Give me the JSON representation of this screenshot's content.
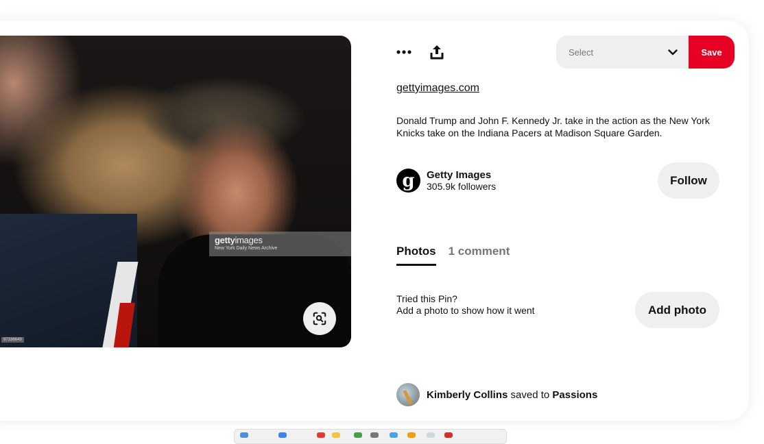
{
  "pin": {
    "image_alt": "Donald Trump and John F. Kennedy Jr. at a Knicks game",
    "watermark": {
      "brand_bold": "getty",
      "brand_light": "images",
      "credit": "New York Daily News Archive"
    },
    "image_id_tag": "97336649",
    "visual_search_icon": "lens-search-icon"
  },
  "toolbar": {
    "more_icon": "more-horizontal-icon",
    "share_icon": "share-icon",
    "board_select": {
      "placeholder": "Select",
      "icon": "chevron-down-icon"
    },
    "save_label": "Save"
  },
  "source_link": "gettyimages.com",
  "description": "Donald Trump and John F. Kennedy Jr. take in the action as the New York Knicks take on the Indiana Pacers at Madison Square Garden.",
  "creator": {
    "avatar_letter": "g",
    "name": "Getty Images",
    "followers": "305.9k followers",
    "follow_label": "Follow"
  },
  "tabs": [
    {
      "label": "Photos",
      "active": true
    },
    {
      "label": "1 comment",
      "active": false
    }
  ],
  "tried": {
    "line1": "Tried this Pin?",
    "line2": "Add a photo to show how it went",
    "button_label": "Add photo"
  },
  "saved_by": {
    "user": "Kimberly Collins",
    "verb": "saved to",
    "board": "Passions"
  },
  "colors": {
    "accent": "#e60023",
    "button_bg": "#efefef",
    "muted_text": "#767676"
  }
}
